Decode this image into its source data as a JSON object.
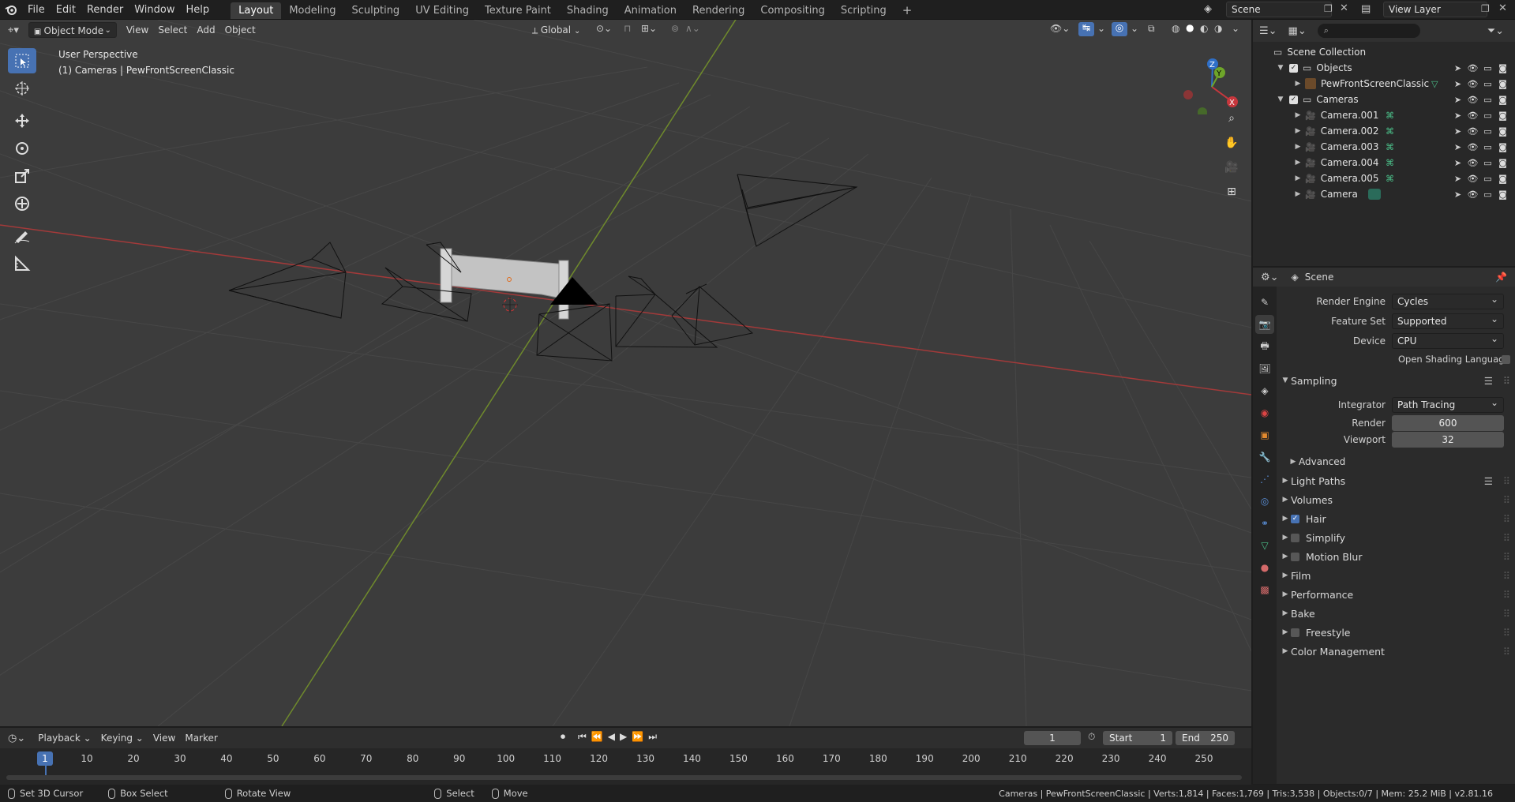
{
  "topbar": {
    "menus": [
      "File",
      "Edit",
      "Render",
      "Window",
      "Help"
    ],
    "workspaces": [
      "Layout",
      "Modeling",
      "Sculpting",
      "UV Editing",
      "Texture Paint",
      "Shading",
      "Animation",
      "Rendering",
      "Compositing",
      "Scripting"
    ],
    "active_workspace": "Layout",
    "add_tab": "+",
    "scene": "Scene",
    "view_layer": "View Layer"
  },
  "viewport": {
    "mode": "Object Mode",
    "menus": [
      "View",
      "Select",
      "Add",
      "Object"
    ],
    "transform_orientation": "Global",
    "info_line1": "User Perspective",
    "info_line2": "(1) Cameras | PewFrontScreenClassic",
    "gizmo": {
      "x": "X",
      "y": "Y",
      "z": "Z"
    }
  },
  "outliner": {
    "search_placeholder": "",
    "root": "Scene Collection",
    "collections": [
      {
        "name": "Objects",
        "children": [
          "PewFrontScreenClassic"
        ]
      },
      {
        "name": "Cameras",
        "children": [
          "Camera.001",
          "Camera.002",
          "Camera.003",
          "Camera.004",
          "Camera.005",
          "Camera"
        ]
      }
    ]
  },
  "properties": {
    "context": "Scene",
    "render_engine_label": "Render Engine",
    "render_engine": "Cycles",
    "feature_set_label": "Feature Set",
    "feature_set": "Supported",
    "device_label": "Device",
    "device": "CPU",
    "osl_label": "Open Shading Language",
    "sampling": "Sampling",
    "integrator_label": "Integrator",
    "integrator": "Path Tracing",
    "render_label": "Render",
    "render_samples": "600",
    "viewport_label": "Viewport",
    "viewport_samples": "32",
    "advanced": "Advanced",
    "panels": [
      {
        "label": "Light Paths",
        "checkbox": null
      },
      {
        "label": "Volumes",
        "checkbox": null
      },
      {
        "label": "Hair",
        "checkbox": true
      },
      {
        "label": "Simplify",
        "checkbox": false
      },
      {
        "label": "Motion Blur",
        "checkbox": false
      },
      {
        "label": "Film",
        "checkbox": null
      },
      {
        "label": "Performance",
        "checkbox": null
      },
      {
        "label": "Bake",
        "checkbox": null
      },
      {
        "label": "Freestyle",
        "checkbox": false
      },
      {
        "label": "Color Management",
        "checkbox": null
      }
    ]
  },
  "timeline": {
    "menus": [
      "Playback",
      "Keying",
      "View",
      "Marker"
    ],
    "current_frame": "1",
    "start_label": "Start",
    "start": "1",
    "end_label": "End",
    "end": "250",
    "ticks": [
      "10",
      "20",
      "30",
      "40",
      "50",
      "60",
      "70",
      "80",
      "90",
      "100",
      "110",
      "120",
      "130",
      "140",
      "150",
      "160",
      "170",
      "180",
      "190",
      "200",
      "210",
      "220",
      "230",
      "240",
      "250"
    ]
  },
  "statusbar": {
    "left": [
      "Set 3D Cursor",
      "Box Select",
      "Rotate View"
    ],
    "mid": [
      "Select",
      "Move"
    ],
    "right": "Cameras | PewFrontScreenClassic | Verts:1,814 | Faces:1,769 | Tris:3,538 | Objects:0/7 | Mem: 25.2 MiB | v2.81.16"
  }
}
